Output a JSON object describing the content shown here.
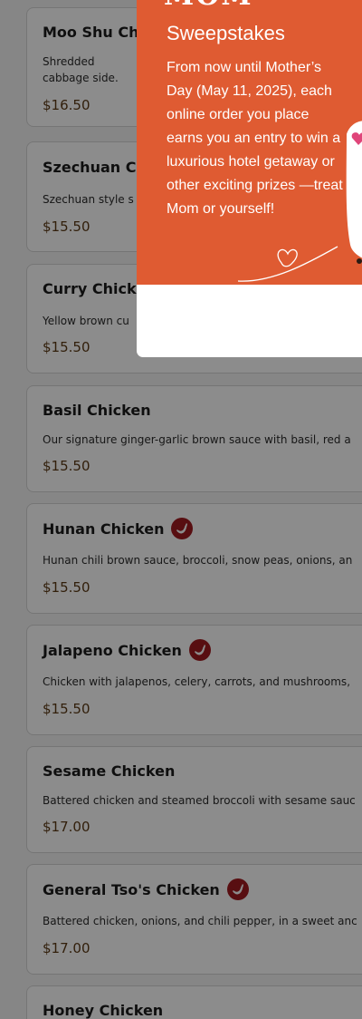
{
  "menu": {
    "items": [
      {
        "name": "Moo Shu Chi",
        "description": "Shredded cabbage side.",
        "price": "$16.50",
        "spicy": false
      },
      {
        "name": "Szechuan Ch",
        "description": "Szechuan style s",
        "price": "$15.50",
        "spicy": false
      },
      {
        "name": "Curry Chicke",
        "description": "Yellow brown cu",
        "price": "$15.50",
        "spicy": false
      },
      {
        "name": "Basil Chicken",
        "description": "Our signature ginger-garlic brown sauce with basil, red a",
        "price": "$15.50",
        "spicy": false
      },
      {
        "name": "Hunan Chicken",
        "description": "Hunan chili brown sauce, broccoli, snow peas, onions, an",
        "price": "$15.50",
        "spicy": true
      },
      {
        "name": "Jalapeno Chicken",
        "description": "Chicken with jalapenos, celery, carrots, and mushrooms,",
        "price": "$15.50",
        "spicy": true
      },
      {
        "name": "Sesame Chicken",
        "description": "Battered chicken and steamed broccoli with sesame sauc",
        "price": "$17.00",
        "spicy": false
      },
      {
        "name": "General Tso's Chicken",
        "description": "Battered chicken, onions, and chili pepper, in a sweet anc",
        "price": "$17.00",
        "spicy": true
      },
      {
        "name": "Honey Chicken",
        "description": "",
        "price": "",
        "spicy": false
      }
    ]
  },
  "promo": {
    "brand_partial": "MOM",
    "title": "Sweepstakes",
    "body": "From now until Mother’s Day (May 11, 2025), each online order you place earns you an entry to win a luxurious hotel getaway or other exciting prizes —treat Mom or yourself!",
    "background_color": "#df5b32"
  },
  "colors": {
    "spicy_icon": "#a11a1f",
    "price": "#5b3a15",
    "overlay": "rgba(0,0,0,0.45)"
  }
}
